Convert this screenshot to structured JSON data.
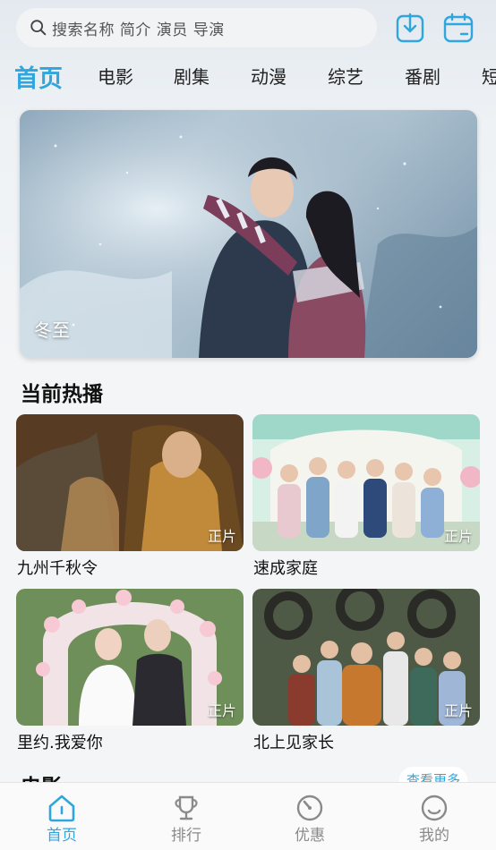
{
  "search": {
    "placeholder": "搜索名称 简介 演员 导演"
  },
  "header_icons": {
    "download": "download-icon",
    "calendar": "calendar-icon"
  },
  "tabs": [
    {
      "label": "首页",
      "active": true
    },
    {
      "label": "电影"
    },
    {
      "label": "剧集"
    },
    {
      "label": "动漫"
    },
    {
      "label": "综艺"
    },
    {
      "label": "番剧"
    },
    {
      "label": "短"
    }
  ],
  "banner": {
    "caption": "冬至"
  },
  "hot_section": {
    "title": "当前热播",
    "items": [
      {
        "title": "九州千秋令",
        "badge": "正片"
      },
      {
        "title": "速成家庭",
        "badge": "正片"
      },
      {
        "title": "里约.我爱你",
        "badge": "正片"
      },
      {
        "title": "北上见家长",
        "badge": "正片"
      }
    ]
  },
  "movie_section": {
    "title": "电影",
    "more": "查看更多"
  },
  "bottom_nav": [
    {
      "label": "首页",
      "icon": "home-icon",
      "active": true
    },
    {
      "label": "排行",
      "icon": "trophy-icon"
    },
    {
      "label": "优惠",
      "icon": "discount-dial-icon"
    },
    {
      "label": "我的",
      "icon": "smiley-profile-icon"
    }
  ],
  "colors": {
    "accent": "#2fa6de",
    "background": "#f4f5f7",
    "nav_inactive": "#8a8a8a"
  }
}
